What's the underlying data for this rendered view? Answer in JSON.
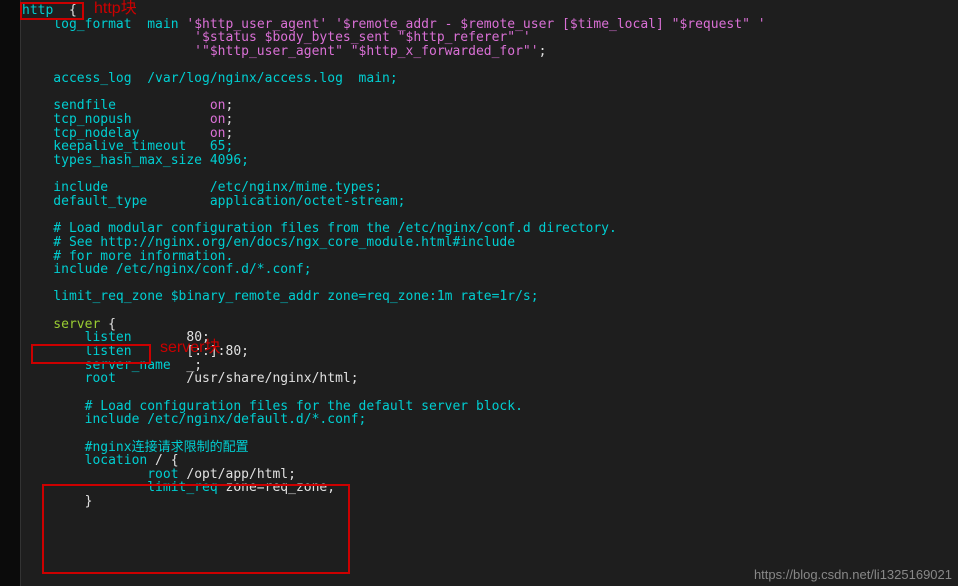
{
  "annotations": {
    "http_label": "http块",
    "server_label": "server块"
  },
  "watermark": "https://blog.csdn.net/li1325169021",
  "code": {
    "l1_http": "http",
    "l1_brace": "  {",
    "l2": "    log_format  main ",
    "l2s": "'$http_user_agent' '$remote_addr - $remote_user [$time_local] \"$request\" '",
    "l3s": "                      '$status $body_bytes_sent \"$http_referer\" '",
    "l4s": "                      '\"$http_user_agent\" \"$http_x_forwarded_for\"'",
    "l4p": ";",
    "l6": "    access_log  /var/log/nginx/access.log  main;",
    "l8a": "    sendfile            ",
    "l8b": "on",
    "l8c": ";",
    "l9a": "    tcp_nopush          ",
    "l9b": "on",
    "l10a": "    tcp_nodelay         ",
    "l10b": "on",
    "l11": "    keepalive_timeout   65;",
    "l12": "    types_hash_max_size 4096;",
    "l14": "    include             /etc/nginx/mime.types;",
    "l15": "    default_type        application/octet-stream;",
    "l17": "    # Load modular configuration files from the /etc/nginx/conf.d directory.",
    "l18": "    # See http://nginx.org/en/docs/ngx_core_module.html#include",
    "l19": "    # for more information.",
    "l20": "    include /etc/nginx/conf.d/*.conf;",
    "l22": "    limit_req_zone $binary_remote_addr zone=req_zone:1m rate=1r/s;",
    "l24a": "    server",
    "l24b": " {",
    "l25a": "        listen",
    "l25b": "       80;",
    "l26a": "        listen",
    "l26b": "       [::]:80;",
    "l27a": "        server_name",
    "l27b": "  _;",
    "l28a": "        root",
    "l28b": "         /usr/share/nginx/html;",
    "l30": "        # Load configuration files for the default server block.",
    "l31": "        include /etc/nginx/default.d/*.conf;",
    "l33": "        #nginx连接请求限制的配置",
    "l34a": "        location",
    "l34b": " / {",
    "l35a": "                root",
    "l35b": " /opt/app/html;",
    "l36a": "                limit_req",
    "l36b": " zone=req_zone;",
    "l37": "        }"
  }
}
